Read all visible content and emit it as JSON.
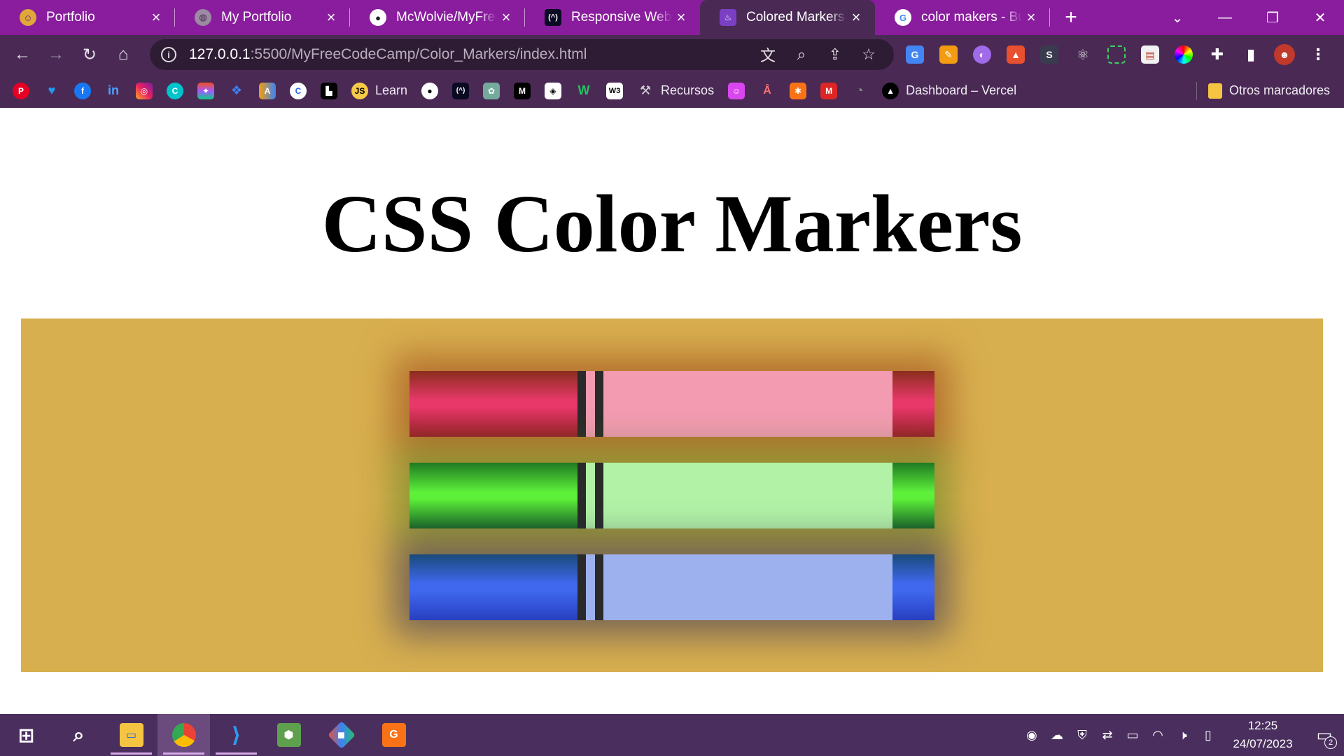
{
  "tabs": [
    {
      "title": "Portfolio",
      "icon": "portfolio-logo-icon",
      "color": "#e0a83a"
    },
    {
      "title": "My Portfolio",
      "icon": "globe-icon",
      "color": "#9c8aa3"
    },
    {
      "title": "McWolvie/MyFreeCodeCamp",
      "icon": "github-icon",
      "color": "#ffffff"
    },
    {
      "title": "Responsive Web Design",
      "icon": "freecodecamp-icon",
      "color": "#0a0a23"
    },
    {
      "title": "Colored Markers",
      "icon": "colors-page-icon",
      "color": "#7b3fc4"
    },
    {
      "title": "color makers - Búsqueda de Google",
      "icon": "google-icon",
      "color": "#ffffff"
    }
  ],
  "active_tab": "Colored Markers",
  "address": {
    "host": "127.0.0.1",
    "path": ":5500/MyFreeCodeCamp/Color_Markers/index.html"
  },
  "bookmarks": {
    "learn": "Learn",
    "recursos": "Recursos",
    "vercel": "Dashboard – Vercel",
    "otros": "Otros marcadores",
    "js_badge": "JS"
  },
  "page": {
    "heading": "CSS Color Markers",
    "markers": [
      {
        "name": "red",
        "cap": "#e8386a",
        "sleeve": "#f29bb1"
      },
      {
        "name": "green",
        "cap": "#5df03a",
        "sleeve": "#b2f2a6"
      },
      {
        "name": "blue",
        "cap": "#3f68ef",
        "sleeve": "#9eb1ef"
      }
    ],
    "container_color": "#d8af4f"
  },
  "taskbar": {
    "time": "12:25",
    "date": "24/07/2023",
    "notification_count": "2"
  }
}
